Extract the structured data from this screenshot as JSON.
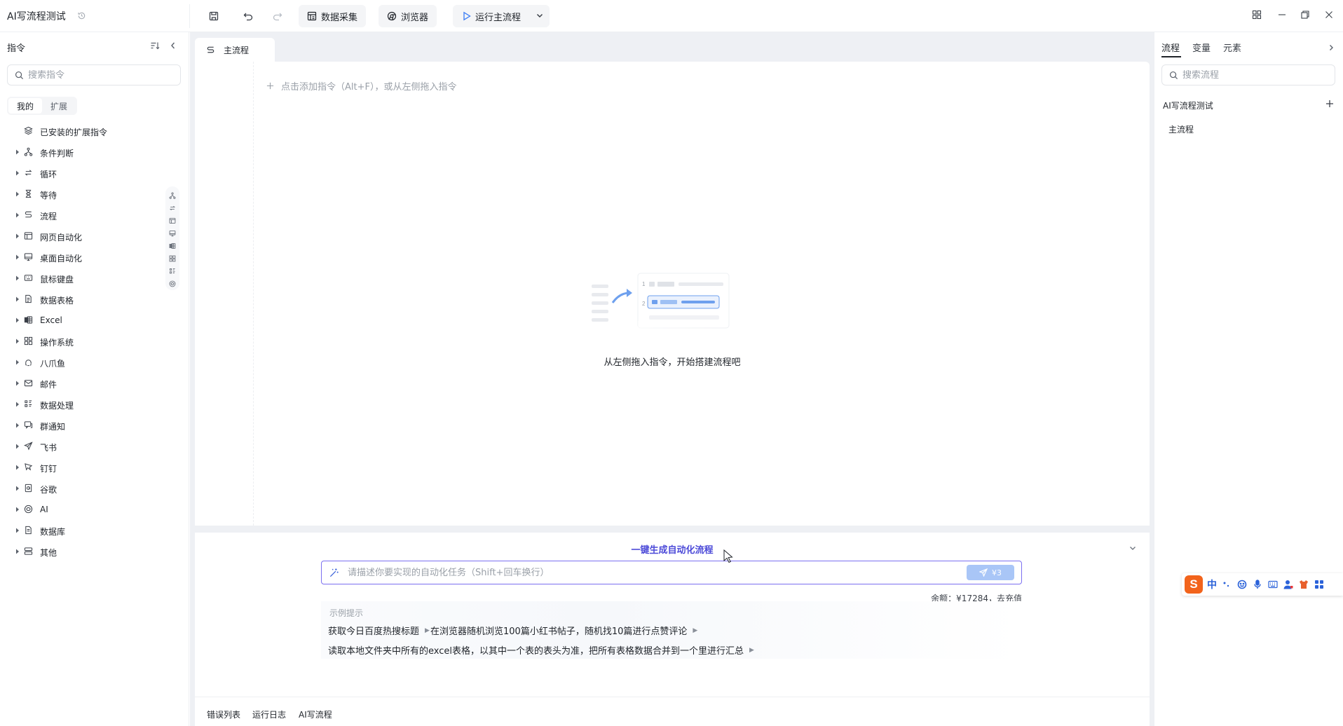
{
  "app": {
    "title": "AI写流程测试"
  },
  "toolbar": {
    "data_collect": "数据采集",
    "browser": "浏览器",
    "run_main": "运行主流程"
  },
  "left": {
    "title": "指令",
    "search_placeholder": "搜索指令",
    "tabs": [
      "我的",
      "扩展"
    ],
    "items": [
      {
        "label": "已安装的扩展指令",
        "icon": "extension-stack-icon",
        "expandable": false
      },
      {
        "label": "条件判断",
        "icon": "branch-icon",
        "expandable": true
      },
      {
        "label": "循环",
        "icon": "loop-icon",
        "expandable": true
      },
      {
        "label": "等待",
        "icon": "hourglass-icon",
        "expandable": true
      },
      {
        "label": "流程",
        "icon": "flow-icon",
        "expandable": true
      },
      {
        "label": "网页自动化",
        "icon": "web-page-icon",
        "expandable": true
      },
      {
        "label": "桌面自动化",
        "icon": "desktop-icon",
        "expandable": true
      },
      {
        "label": "鼠标键盘",
        "icon": "keyboard-icon",
        "expandable": true
      },
      {
        "label": "数据表格",
        "icon": "document-icon",
        "expandable": true
      },
      {
        "label": "Excel",
        "icon": "excel-icon",
        "expandable": true
      },
      {
        "label": "操作系统",
        "icon": "grid-icon",
        "expandable": true
      },
      {
        "label": "八爪鱼",
        "icon": "octopus-icon",
        "expandable": true
      },
      {
        "label": "邮件",
        "icon": "mail-icon",
        "expandable": true
      },
      {
        "label": "数据处理",
        "icon": "data-process-icon",
        "expandable": true
      },
      {
        "label": "群通知",
        "icon": "notify-icon",
        "expandable": true
      },
      {
        "label": "飞书",
        "icon": "paper-plane-icon",
        "expandable": true
      },
      {
        "label": "钉钉",
        "icon": "dingtalk-icon",
        "expandable": true
      },
      {
        "label": "谷歌",
        "icon": "google-icon",
        "expandable": true
      },
      {
        "label": "AI",
        "icon": "ai-icon",
        "expandable": true
      },
      {
        "label": "数据库",
        "icon": "database-icon",
        "expandable": true
      },
      {
        "label": "其他",
        "icon": "other-icon",
        "expandable": true
      }
    ]
  },
  "editor": {
    "tab": "主流程",
    "add_hint": "点击添加指令（Alt+F），或从左侧拖入指令",
    "empty_text": "从左侧拖入指令，开始搭建流程吧"
  },
  "ai": {
    "title": "一键生成自动化流程",
    "placeholder": "请描述你要实现的自动化任务（Shift+回车换行）",
    "send_cost": "¥3",
    "balance_text": "余额：¥17284，",
    "recharge": "去充值",
    "examples_label": "示例提示",
    "examples": [
      "获取今日百度热搜标题",
      "在浏览器随机浏览100篇小红书帖子，随机找10篇进行点赞评论",
      "读取本地文件夹中所有的excel表格，以其中一个表的表头为准，把所有表格数据合并到一个里进行汇总"
    ]
  },
  "bottom_tabs": [
    "错误列表",
    "运行日志",
    "AI写流程"
  ],
  "right": {
    "tabs": [
      "流程",
      "变量",
      "元素"
    ],
    "search_placeholder": "搜索流程",
    "project": "AI写流程测试",
    "flows": [
      "主流程"
    ]
  },
  "ime": {
    "lang": "中"
  },
  "colors": {
    "accent": "#4b49d8",
    "input_border": "#7b6ff0",
    "send_bg": "#a9c6f7",
    "ime_logo": "#f2631b"
  }
}
